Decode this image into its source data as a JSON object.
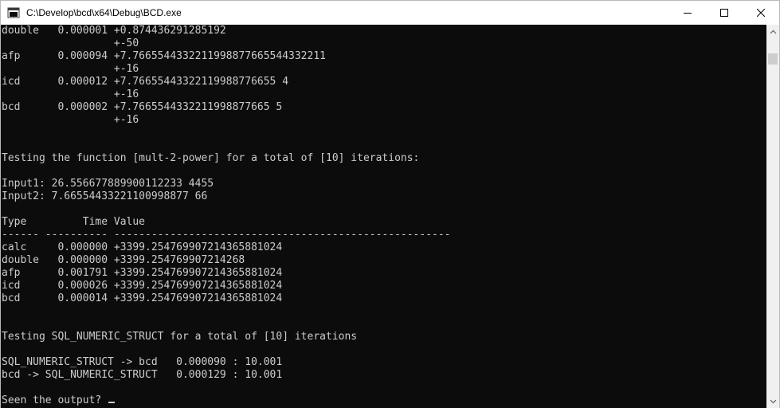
{
  "window": {
    "title": "C:\\Develop\\bcd\\x64\\Debug\\BCD.exe",
    "controls": {
      "minimize_icon": "minimize-icon",
      "maximize_icon": "maximize-icon",
      "close_icon": "close-icon"
    }
  },
  "console": {
    "lines": [
      "double   0.000001 +0.874436291285192",
      "                  +-50",
      "afp      0.000094 +7.7665544332211998877665544332211",
      "                  +-16",
      "icd      0.000012 +7.76655443322119988776655 4",
      "                  +-16",
      "bcd      0.000002 +7.7665544332211998877665 5",
      "                  +-16",
      "",
      "",
      "Testing the function [mult-2-power] for a total of [10] iterations:",
      "",
      "Input1: 26.556677889900112233 4455",
      "Input2: 7.66554433221100998877 66",
      "",
      "Type         Time Value",
      "------ ---------- ------------------------------------------------------",
      "calc     0.000000 +3399.254769907214365881024",
      "double   0.000000 +3399.254769907214268",
      "afp      0.001791 +3399.254769907214365881024",
      "icd      0.000026 +3399.254769907214365881024",
      "bcd      0.000014 +3399.254769907214365881024",
      "",
      "",
      "Testing SQL_NUMERIC_STRUCT for a total of [10] iterations",
      "",
      "SQL_NUMERIC_STRUCT -> bcd   0.000090 : 10.001",
      "bcd -> SQL_NUMERIC_STRUCT   0.000129 : 10.001",
      "",
      "Seen the output? "
    ]
  },
  "colors": {
    "console_background": "#0c0c0c",
    "console_text": "#cccccc",
    "titlebar_background": "#ffffff",
    "scrollbar_track": "#f0f0f0",
    "scrollbar_thumb": "#cdcdcd"
  }
}
